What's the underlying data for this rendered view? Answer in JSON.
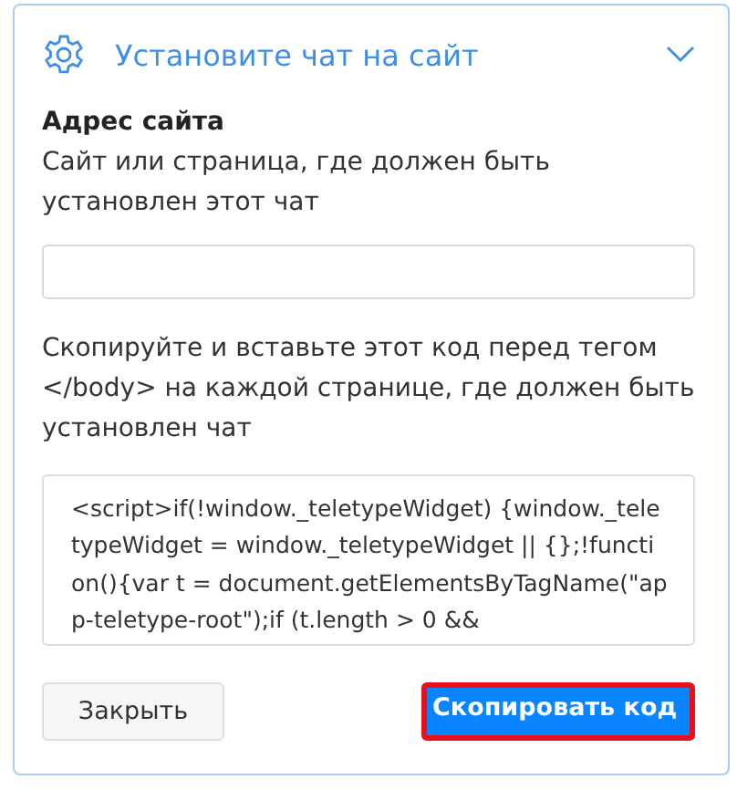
{
  "header": {
    "title": "Установите чат на сайт",
    "expanded": true
  },
  "site_field": {
    "label": "Адрес сайта",
    "hint": "Сайт или страница, где должен быть установлен этот чат"
  },
  "code_section": {
    "instructions": "Скопируйте и вставьте этот код перед тегом </body> на каждой странице, где должен быть установлен чат",
    "code": "<script>if(!window._teletypeWidget) {window._teletypeWidget = window._teletypeWidget || {};!function(){var t = document.getElementsByTagName(\"app-teletype-root\");if (t.length > 0 &&"
  },
  "buttons": [
    {
      "label": "Закрыть",
      "kind": "secondary",
      "highlighted": false
    },
    {
      "label": "Скопировать код",
      "kind": "primary",
      "highlighted": true
    }
  ]
}
